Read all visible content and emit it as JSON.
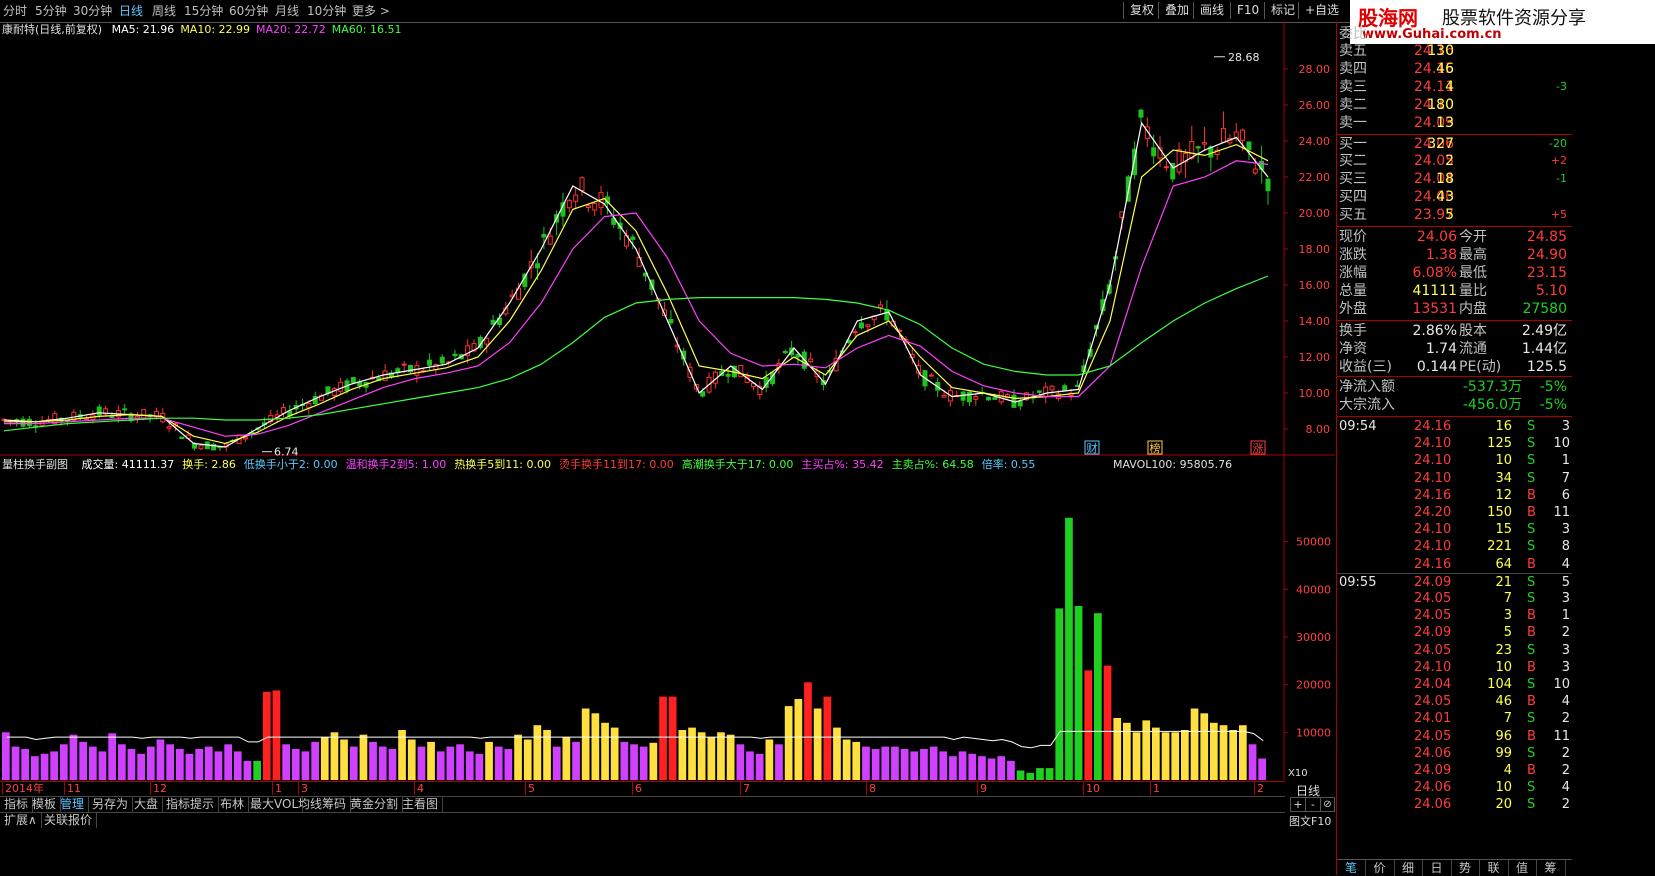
{
  "toolbar": {
    "periods": [
      "分时",
      "5分钟",
      "30分钟",
      "日线",
      "周线",
      "15分钟",
      "60分钟",
      "月线",
      "10分钟",
      "更多 >"
    ],
    "active_period": "日线",
    "right_buttons": [
      "复权",
      "叠加",
      "画线",
      "F10",
      "标记",
      "+自选"
    ]
  },
  "logo": {
    "brand": "股海网",
    "slogan": "股票软件资源分享",
    "url": "www.Guhai.com.cn"
  },
  "chart_header": {
    "title": "康耐特(日线,前复权)",
    "ma": [
      {
        "label": "MA5: 21.96",
        "color": "#ffffff"
      },
      {
        "label": "MA10: 22.99",
        "color": "#ffff50"
      },
      {
        "label": "MA20: 22.72",
        "color": "#ff40ff"
      },
      {
        "label": "MA60: 16.51",
        "color": "#40ff40"
      }
    ]
  },
  "chart_data": [
    {
      "type": "line",
      "title": "康耐特(日线,前复权)",
      "price_axis": [
        "28.00",
        "26.00",
        "24.00",
        "22.00",
        "20.00",
        "18.00",
        "16.00",
        "14.00",
        "12.00",
        "10.00",
        "8.00"
      ],
      "ylim": [
        7,
        29.5
      ],
      "annotations": [
        {
          "text": "28.68"
        },
        {
          "text": "6.74"
        }
      ],
      "markers": [
        "财",
        "榜",
        "涨"
      ],
      "series": [
        {
          "name": "MA5",
          "color": "#ffffff",
          "values": [
            8.5,
            8.4,
            8.6,
            8.9,
            8.8,
            8.7,
            7.2,
            7.0,
            8.0,
            9.0,
            9.8,
            10.5,
            11.0,
            11.3,
            11.6,
            12.5,
            15.0,
            18.0,
            21.5,
            20.5,
            18.0,
            14.0,
            10.0,
            11.5,
            10.2,
            12.5,
            10.5,
            14.0,
            14.5,
            11.0,
            9.8,
            10.0,
            9.5,
            10.0,
            10.2,
            16.0,
            25.0,
            22.5,
            23.5,
            24.2,
            22.0
          ]
        },
        {
          "name": "MA10",
          "color": "#ffff50",
          "values": [
            8.4,
            8.4,
            8.5,
            8.7,
            8.8,
            8.7,
            7.6,
            7.2,
            7.8,
            8.7,
            9.4,
            10.2,
            10.8,
            11.1,
            11.4,
            12.0,
            14.0,
            16.8,
            20.2,
            20.8,
            19.0,
            15.5,
            11.5,
            11.2,
            10.8,
            12.0,
            11.0,
            13.2,
            14.0,
            12.0,
            10.3,
            10.0,
            9.7,
            9.8,
            10.0,
            14.0,
            22.0,
            23.5,
            23.2,
            23.8,
            22.9
          ]
        },
        {
          "name": "MA20",
          "color": "#ff40ff",
          "values": [
            8.3,
            8.3,
            8.4,
            8.5,
            8.6,
            8.6,
            8.1,
            7.6,
            7.7,
            8.2,
            8.9,
            9.6,
            10.3,
            10.8,
            11.1,
            11.5,
            12.8,
            15.0,
            18.0,
            19.8,
            20.0,
            17.5,
            14.0,
            12.2,
            11.5,
            11.6,
            11.4,
            12.5,
            13.2,
            12.6,
            11.2,
            10.4,
            10.0,
            9.8,
            9.8,
            11.5,
            17.0,
            21.5,
            22.0,
            22.9,
            22.7
          ]
        },
        {
          "name": "MA60",
          "color": "#40ff40",
          "values": [
            7.9,
            8.1,
            8.3,
            8.4,
            8.5,
            8.6,
            8.6,
            8.5,
            8.5,
            8.6,
            8.8,
            9.1,
            9.4,
            9.7,
            10.0,
            10.3,
            10.8,
            11.6,
            12.8,
            14.2,
            15.0,
            15.2,
            15.3,
            15.3,
            15.3,
            15.3,
            15.2,
            15.0,
            14.6,
            13.8,
            12.5,
            11.6,
            11.2,
            11.0,
            11.0,
            11.5,
            12.8,
            14.0,
            15.0,
            15.8,
            16.5
          ]
        }
      ]
    },
    {
      "type": "bar",
      "title": "量柱换手副图",
      "legend": [
        {
          "label": "成交量: 41111.37",
          "color": "#ffffff"
        },
        {
          "label": "换手: 2.86",
          "color": "#ffff50"
        },
        {
          "label": "低换手小于2: 0.00",
          "color": "#5cc8ff"
        },
        {
          "label": "温和换手2到5: 1.00",
          "color": "#ff40ff"
        },
        {
          "label": "热换手5到11: 0.00",
          "color": "#ffff50"
        },
        {
          "label": "烫手换手11到17: 0.00",
          "color": "#ff3c3c"
        },
        {
          "label": "高潮换手大于17: 0.00",
          "color": "#40ff40"
        },
        {
          "label": "主买占%: 35.42",
          "color": "#ff40ff"
        },
        {
          "label": "主卖占%: 64.58",
          "color": "#40ff40"
        },
        {
          "label": "倍率: 0.55",
          "color": "#5cc8ff"
        }
      ],
      "mavol_label": "MAVOL100: 95805.76",
      "volume_axis": [
        "50000",
        "40000",
        "30000",
        "20000",
        "10000"
      ],
      "x10_label": "X10",
      "ylim": [
        0,
        60000
      ],
      "colors": {
        "magenta": "#d040ff",
        "yellow": "#ffe040",
        "red": "#ff2020",
        "green": "#20d020"
      },
      "values": [
        10000,
        7000,
        6500,
        5000,
        5500,
        6000,
        7500,
        9500,
        8000,
        7000,
        6000,
        9800,
        7500,
        6500,
        5500,
        7000,
        8500,
        7500,
        6500,
        5500,
        6500,
        7000,
        6000,
        7500,
        6000,
        4000,
        4000,
        18500,
        18800,
        7500,
        6500,
        6000,
        8000,
        9000,
        10000,
        8500,
        7000,
        9500,
        8000,
        7000,
        6500,
        10500,
        8500,
        7000,
        8000,
        6000,
        7000,
        7500,
        6000,
        5500,
        8000,
        7000,
        6500,
        9500,
        8500,
        11500,
        10500,
        7000,
        9000,
        8000,
        15000,
        14000,
        12000,
        11000,
        8000,
        7500,
        7000,
        7800,
        17500,
        17500,
        10500,
        11000,
        10000,
        9000,
        10000,
        9500,
        7500,
        6000,
        5500,
        8500,
        7500,
        15500,
        17000,
        20500,
        15000,
        17500,
        11000,
        8500,
        8000,
        7000,
        6500,
        7000,
        7000,
        6500,
        6000,
        6500,
        7000,
        6000,
        5000,
        6000,
        5500,
        5000,
        4500,
        5000,
        4000,
        2000,
        1500,
        2500,
        2500,
        36000,
        55000,
        36500,
        23000,
        35000,
        24000,
        13000,
        12000,
        10000,
        12500,
        11000,
        10000,
        10000,
        10500,
        15000,
        14000,
        12000,
        11500,
        10500,
        11500,
        7500,
        4500
      ],
      "value_colors": [
        "magenta",
        "magenta",
        "magenta",
        "magenta",
        "magenta",
        "magenta",
        "magenta",
        "magenta",
        "magenta",
        "magenta",
        "magenta",
        "magenta",
        "magenta",
        "magenta",
        "magenta",
        "magenta",
        "magenta",
        "magenta",
        "magenta",
        "magenta",
        "magenta",
        "magenta",
        "magenta",
        "magenta",
        "magenta",
        "magenta",
        "green",
        "red",
        "red",
        "magenta",
        "magenta",
        "magenta",
        "magenta",
        "yellow",
        "yellow",
        "yellow",
        "magenta",
        "yellow",
        "magenta",
        "magenta",
        "magenta",
        "yellow",
        "yellow",
        "magenta",
        "yellow",
        "magenta",
        "magenta",
        "magenta",
        "magenta",
        "magenta",
        "yellow",
        "magenta",
        "magenta",
        "yellow",
        "yellow",
        "yellow",
        "yellow",
        "magenta",
        "yellow",
        "magenta",
        "yellow",
        "yellow",
        "yellow",
        "yellow",
        "magenta",
        "magenta",
        "magenta",
        "yellow",
        "red",
        "red",
        "yellow",
        "yellow",
        "yellow",
        "yellow",
        "yellow",
        "yellow",
        "magenta",
        "magenta",
        "magenta",
        "yellow",
        "magenta",
        "yellow",
        "yellow",
        "red",
        "yellow",
        "red",
        "yellow",
        "yellow",
        "yellow",
        "magenta",
        "magenta",
        "magenta",
        "magenta",
        "magenta",
        "magenta",
        "magenta",
        "magenta",
        "magenta",
        "magenta",
        "magenta",
        "magenta",
        "magenta",
        "magenta",
        "magenta",
        "magenta",
        "green",
        "green",
        "green",
        "green",
        "green",
        "green",
        "green",
        "red",
        "green",
        "red",
        "yellow",
        "yellow",
        "yellow",
        "yellow",
        "yellow",
        "yellow",
        "yellow",
        "yellow",
        "yellow",
        "yellow",
        "yellow",
        "yellow",
        "yellow",
        "yellow",
        "magenta",
        "magenta"
      ]
    }
  ],
  "time_axis": [
    "2014年",
    "11",
    "12",
    "1",
    "3",
    "4",
    "5",
    "6",
    "7",
    "8",
    "9",
    "10",
    "1",
    "2"
  ],
  "bottom_tabs": [
    "指标",
    "模板",
    "管理",
    "另存为",
    "大盘",
    "指标提示",
    "布林",
    "最大VOL",
    "均线筹码",
    "黄金分割",
    "主看图"
  ],
  "bottom_row2": [
    "扩展∧",
    "关联报价"
  ],
  "right_panel": {
    "header": "委比",
    "orderbook": [
      {
        "label": "卖五",
        "price": "24.16",
        "vol": "130",
        "chg": ""
      },
      {
        "label": "卖四",
        "price": "24.15",
        "vol": "46",
        "chg": ""
      },
      {
        "label": "卖三",
        "price": "24.11",
        "vol": "4",
        "chg": "-3"
      },
      {
        "label": "卖二",
        "price": "24.10",
        "vol": "180",
        "chg": ""
      },
      {
        "label": "卖一",
        "price": "24.09",
        "vol": "13",
        "chg": ""
      },
      {
        "label": "买一",
        "price": "24.06",
        "vol": "327",
        "chg": "-20"
      },
      {
        "label": "买二",
        "price": "24.05",
        "vol": "2",
        "chg": "+2"
      },
      {
        "label": "买三",
        "price": "24.04",
        "vol": "18",
        "chg": "-1"
      },
      {
        "label": "买四",
        "price": "24.00",
        "vol": "43",
        "chg": ""
      },
      {
        "label": "买五",
        "price": "23.97",
        "vol": "5",
        "chg": "+5"
      }
    ],
    "quote": [
      {
        "l1": "现价",
        "v1": "24.06",
        "l2": "今开",
        "v2": "24.85",
        "c1": "red",
        "c2": "red"
      },
      {
        "l1": "涨跌",
        "v1": "1.38",
        "l2": "最高",
        "v2": "24.90",
        "c1": "red",
        "c2": "red"
      },
      {
        "l1": "涨幅",
        "v1": "6.08%",
        "l2": "最低",
        "v2": "23.15",
        "c1": "red",
        "c2": "red"
      },
      {
        "l1": "总量",
        "v1": "41111",
        "l2": "量比",
        "v2": "5.10",
        "c1": "yellow",
        "c2": "red"
      },
      {
        "l1": "外盘",
        "v1": "13531",
        "l2": "内盘",
        "v2": "27580",
        "c1": "red",
        "c2": "green"
      }
    ],
    "fundamentals": [
      {
        "l1": "换手",
        "v1": "2.86%",
        "l2": "股本",
        "v2": "2.49亿"
      },
      {
        "l1": "净资",
        "v1": "1.74",
        "l2": "流通",
        "v2": "1.44亿"
      },
      {
        "l1": "收益(三)",
        "v1": "0.144",
        "l2": "PE(动)",
        "v2": "125.5"
      }
    ],
    "flows": [
      {
        "label": "净流入额",
        "value": "-537.3万",
        "pct": "-5%"
      },
      {
        "label": "大宗流入",
        "value": "-456.0万",
        "pct": "-5%"
      }
    ],
    "ticks": [
      {
        "time": "09:54",
        "price": "24.16",
        "vol": "16",
        "side": "S",
        "n": "3"
      },
      {
        "time": "",
        "price": "24.10",
        "vol": "125",
        "side": "S",
        "n": "10"
      },
      {
        "time": "",
        "price": "24.10",
        "vol": "10",
        "side": "S",
        "n": "1"
      },
      {
        "time": "",
        "price": "24.10",
        "vol": "34",
        "side": "S",
        "n": "7"
      },
      {
        "time": "",
        "price": "24.16",
        "vol": "12",
        "side": "B",
        "n": "6"
      },
      {
        "time": "",
        "price": "24.20",
        "vol": "150",
        "side": "B",
        "n": "11"
      },
      {
        "time": "",
        "price": "24.10",
        "vol": "15",
        "side": "S",
        "n": "3"
      },
      {
        "time": "",
        "price": "24.10",
        "vol": "221",
        "side": "S",
        "n": "8"
      },
      {
        "time": "",
        "price": "24.16",
        "vol": "64",
        "side": "B",
        "n": "4"
      },
      {
        "time": "09:55",
        "price": "24.09",
        "vol": "21",
        "side": "S",
        "n": "5"
      },
      {
        "time": "",
        "price": "24.05",
        "vol": "7",
        "side": "S",
        "n": "3"
      },
      {
        "time": "",
        "price": "24.05",
        "vol": "3",
        "side": "B",
        "n": "1"
      },
      {
        "time": "",
        "price": "24.09",
        "vol": "5",
        "side": "B",
        "n": "2"
      },
      {
        "time": "",
        "price": "24.05",
        "vol": "23",
        "side": "S",
        "n": "3"
      },
      {
        "time": "",
        "price": "24.10",
        "vol": "10",
        "side": "B",
        "n": "3"
      },
      {
        "time": "",
        "price": "24.04",
        "vol": "104",
        "side": "S",
        "n": "10"
      },
      {
        "time": "",
        "price": "24.05",
        "vol": "46",
        "side": "B",
        "n": "4"
      },
      {
        "time": "",
        "price": "24.01",
        "vol": "7",
        "side": "S",
        "n": "2"
      },
      {
        "time": "",
        "price": "24.05",
        "vol": "96",
        "side": "B",
        "n": "11"
      },
      {
        "time": "",
        "price": "24.06",
        "vol": "99",
        "side": "S",
        "n": "2"
      },
      {
        "time": "",
        "price": "24.09",
        "vol": "4",
        "side": "B",
        "n": "2"
      },
      {
        "time": "",
        "price": "24.06",
        "vol": "10",
        "side": "S",
        "n": "4"
      },
      {
        "time": "",
        "price": "24.06",
        "vol": "20",
        "side": "S",
        "n": "2"
      }
    ],
    "bottom_tabs": [
      "笔",
      "价",
      "细",
      "日",
      "势",
      "联",
      "值",
      "筹"
    ],
    "active_tab": "笔"
  },
  "side_controls": {
    "period_label": "日线",
    "zoom_in": "+",
    "zoom_out": "-",
    "reset": "⊘",
    "tuwen": "图文F10"
  }
}
